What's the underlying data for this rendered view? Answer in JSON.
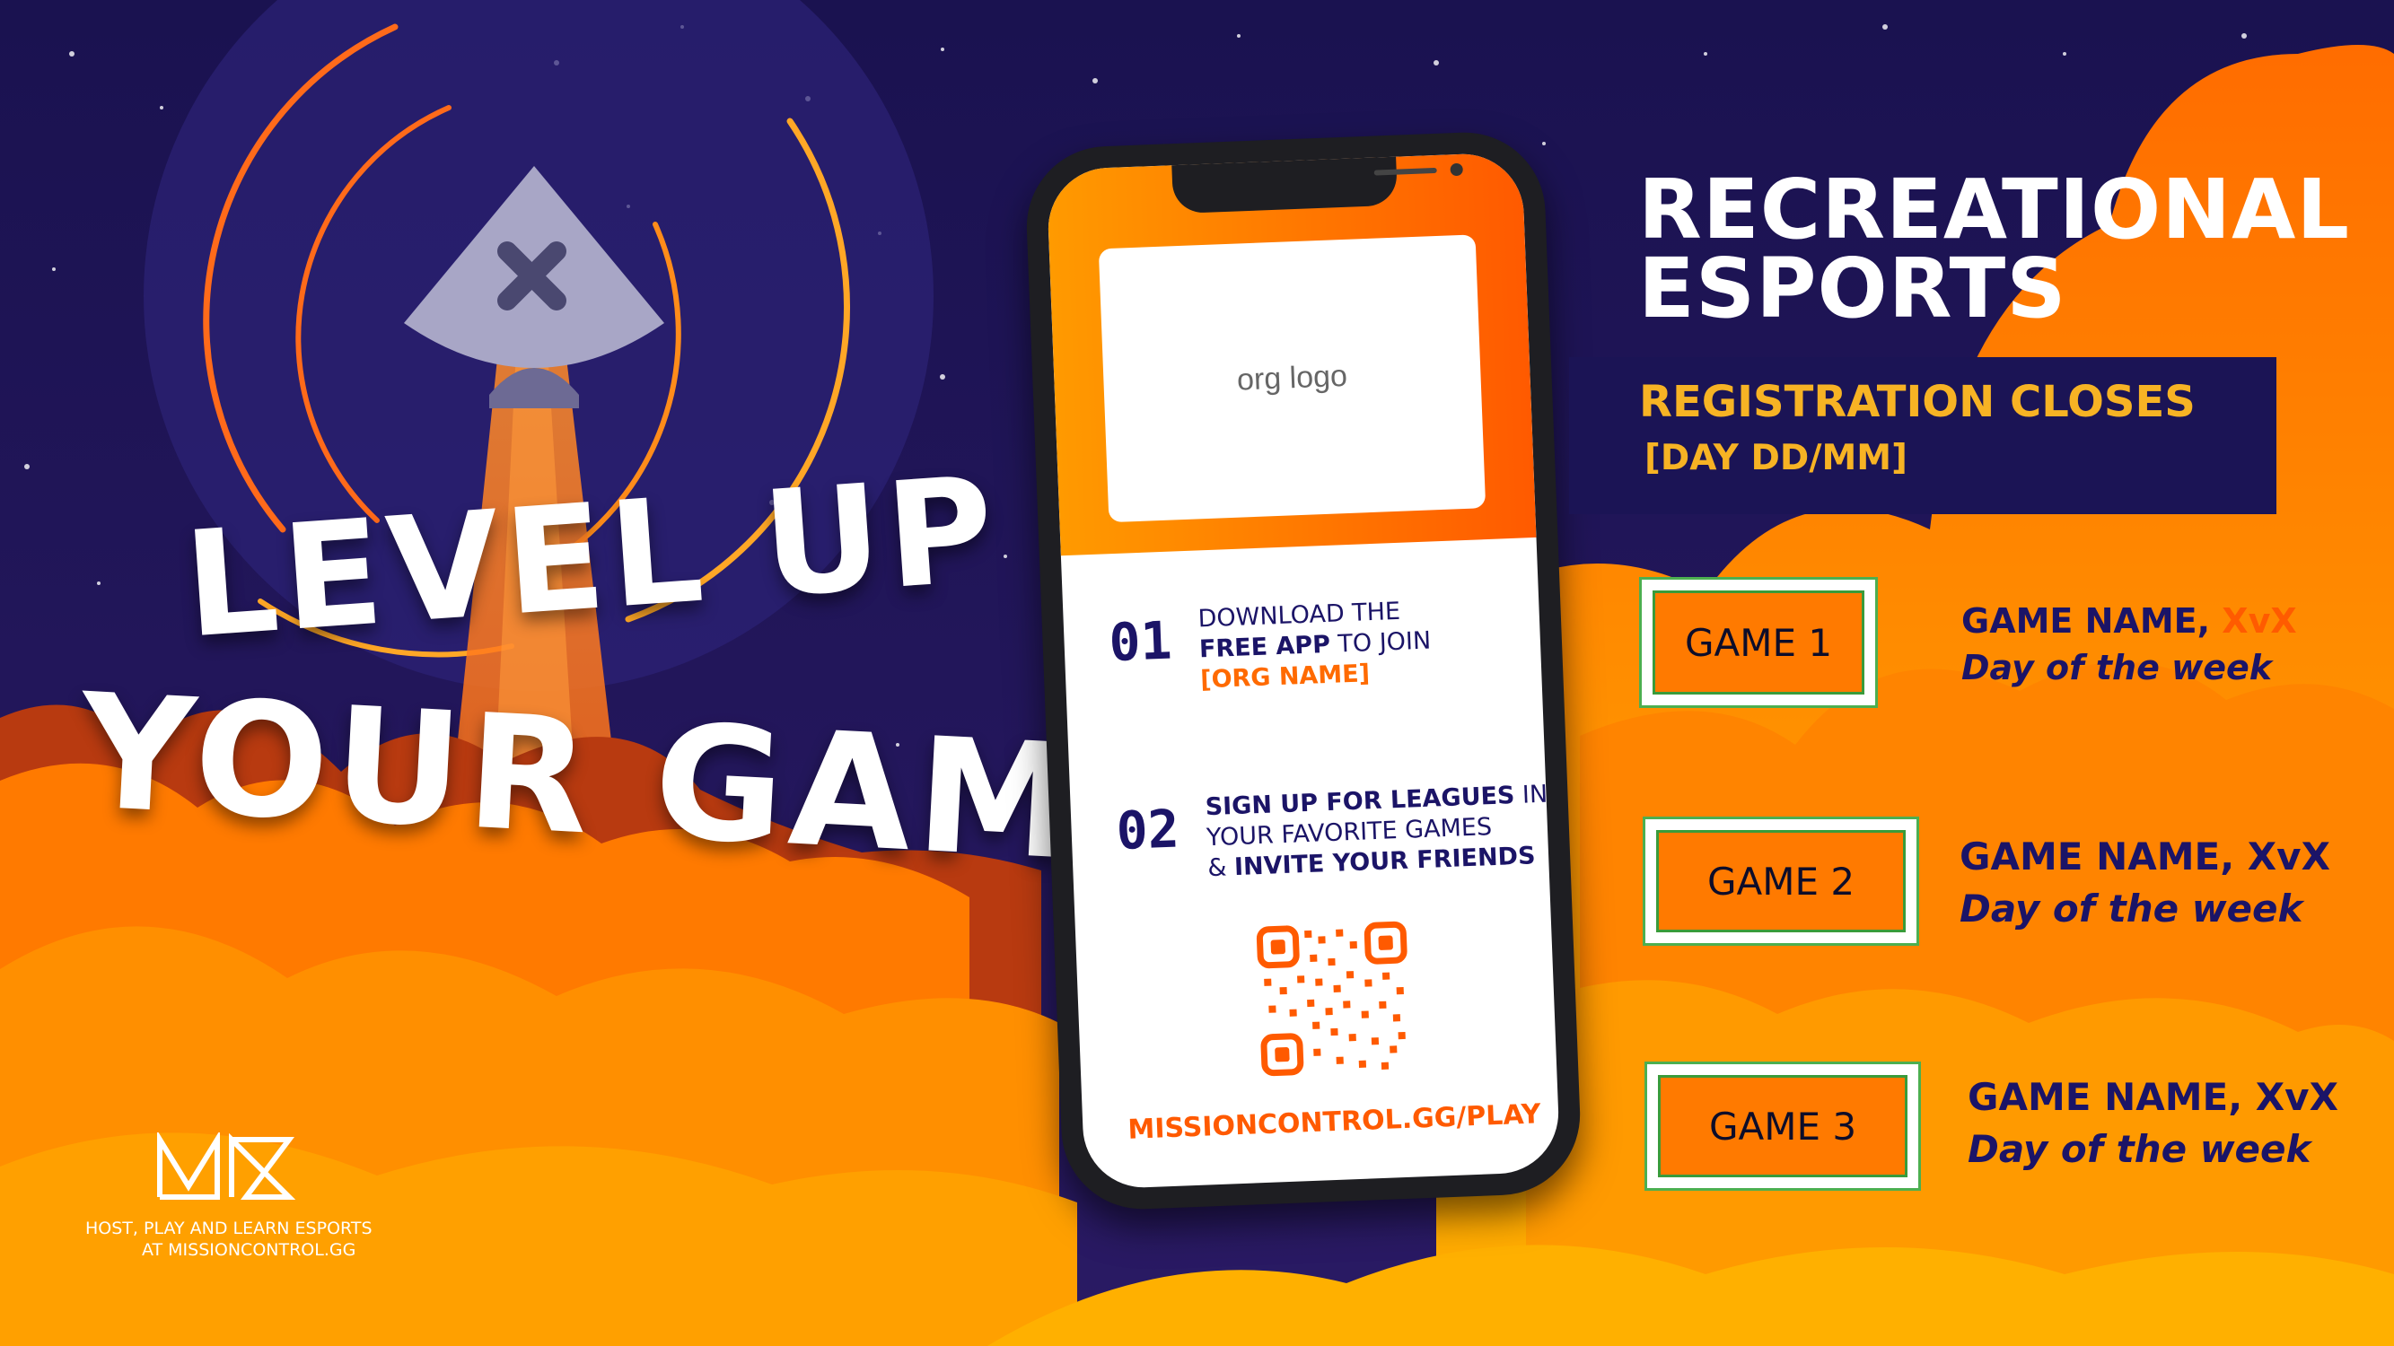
{
  "headline": {
    "line1": "LEVEL UP",
    "line2": "YOUR GAME"
  },
  "title": {
    "line1": "RECREATIONAL",
    "line2": "ESPORTS"
  },
  "registration": {
    "label": "REGISTRATION CLOSES",
    "date": "[DAY DD/MM]"
  },
  "phone": {
    "logo_placeholder": "org logo",
    "step1": {
      "num": "01",
      "line1": "DOWNLOAD THE",
      "bold": "FREE APP",
      "rest": " TO JOIN",
      "org": "[ORG NAME]"
    },
    "step2": {
      "num": "02",
      "line1_bold": "SIGN UP FOR LEAGUES",
      "line1_rest": " IN",
      "line2": "YOUR FAVORITE GAMES",
      "line3_pre": "& ",
      "line3_bold": "INVITE YOUR FRIENDS"
    },
    "url": "MISSIONCONTROL.GG/PLAY"
  },
  "games": [
    {
      "label": "GAME 1",
      "name": "GAME NAME, ",
      "format": "XvX",
      "day": "Day of the week"
    },
    {
      "label": "GAME 2",
      "name": "GAME NAME, XvX",
      "format": "",
      "day": "Day of the week"
    },
    {
      "label": "GAME 3",
      "name": "GAME NAME, XvX",
      "format": "",
      "day": "Day of the week"
    }
  ],
  "footer": {
    "tagline1": "HOST, PLAY AND LEARN ESPORTS",
    "tagline2": "AT MISSIONCONTROL.GG"
  },
  "colors": {
    "navy": "#1f1352",
    "orange": "#ff7a00",
    "yellow": "#f7b324",
    "text_navy": "#1b1467"
  },
  "icons": [
    "rocket-icon",
    "qr-code-icon",
    "missioncontrol-logo-icon"
  ]
}
